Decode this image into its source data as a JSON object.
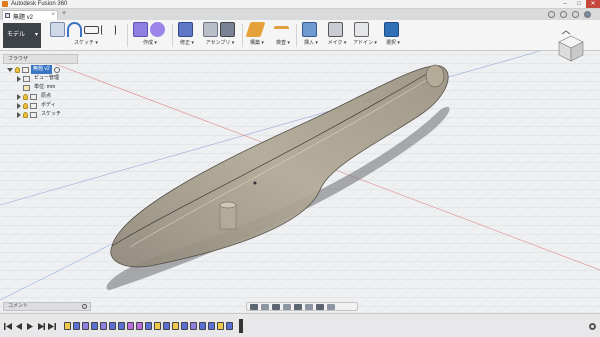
{
  "window": {
    "app_title": "Autodesk Fusion 360",
    "min": "–",
    "max": "□",
    "close": "✕"
  },
  "tabs": {
    "doc_name": "無題 v2",
    "doc_close": "×",
    "add": "+"
  },
  "ribbon": {
    "workspace": "モデル",
    "workspace_caret": "▾",
    "groups": [
      {
        "label": "スケッチ ▾",
        "icons": [
          "edit-sketch-icon",
          "arc-icon",
          "rectangle-icon",
          "line-icon"
        ]
      },
      {
        "label": "作成 ▾",
        "icons": [
          "box-icon",
          "sphere-icon"
        ]
      },
      {
        "label": "修正 ▾",
        "icons": [
          "press-pull-icon"
        ]
      },
      {
        "label": "アセンブリ ▾",
        "icons": [
          "joint-icon",
          "component-icon"
        ]
      },
      {
        "label": "構築 ▾",
        "icons": [
          "plane-icon"
        ]
      },
      {
        "label": "検査 ▾",
        "icons": [
          "measure-icon"
        ]
      },
      {
        "label": "挿入 ▾",
        "icons": [
          "insert-image-icon"
        ]
      },
      {
        "label": "メイク ▾",
        "icons": [
          "3d-print-icon"
        ]
      },
      {
        "label": "アドイン ▾",
        "icons": [
          "scripts-icon"
        ]
      },
      {
        "label": "選択 ▾",
        "icons": [
          "select-icon"
        ]
      }
    ]
  },
  "browser": {
    "header": "ブラウザ",
    "root": "無題 v2",
    "items": [
      "ビュー管理",
      "単位: mm",
      "原点",
      "ボディ",
      "スケッチ"
    ]
  },
  "comments": {
    "label": "コメント"
  },
  "nav_toolbar": {
    "buttons": [
      "orbit-icon",
      "look-at-icon",
      "pan-icon",
      "zoom-icon",
      "fit-icon",
      "display-settings-icon",
      "grid-icon",
      "viewports-icon"
    ]
  },
  "viewcube": {
    "face": "TOP",
    "home": "home-icon"
  },
  "timeline": {
    "controls": [
      "go-to-start-icon",
      "step-back-icon",
      "play-icon",
      "step-forward-icon",
      "go-to-end-icon"
    ],
    "feature_colors": [
      "#f2c94c",
      "#5b6fd6",
      "#8e7fe0",
      "#5b6fd6",
      "#8e7fe0",
      "#5b6fd6",
      "#5b6fd6",
      "#b96fe0",
      "#b96fe0",
      "#5b6fd6",
      "#f2c94c",
      "#5b6fd6",
      "#f2c94c",
      "#5b6fd6",
      "#8e7fe0",
      "#5b6fd6",
      "#5b6fd6",
      "#f2c94c",
      "#5b6fd6"
    ]
  },
  "colors": {
    "accent": "#3877c4",
    "workspace_bg": "#3e4249",
    "close_btn": "#c8473c"
  }
}
